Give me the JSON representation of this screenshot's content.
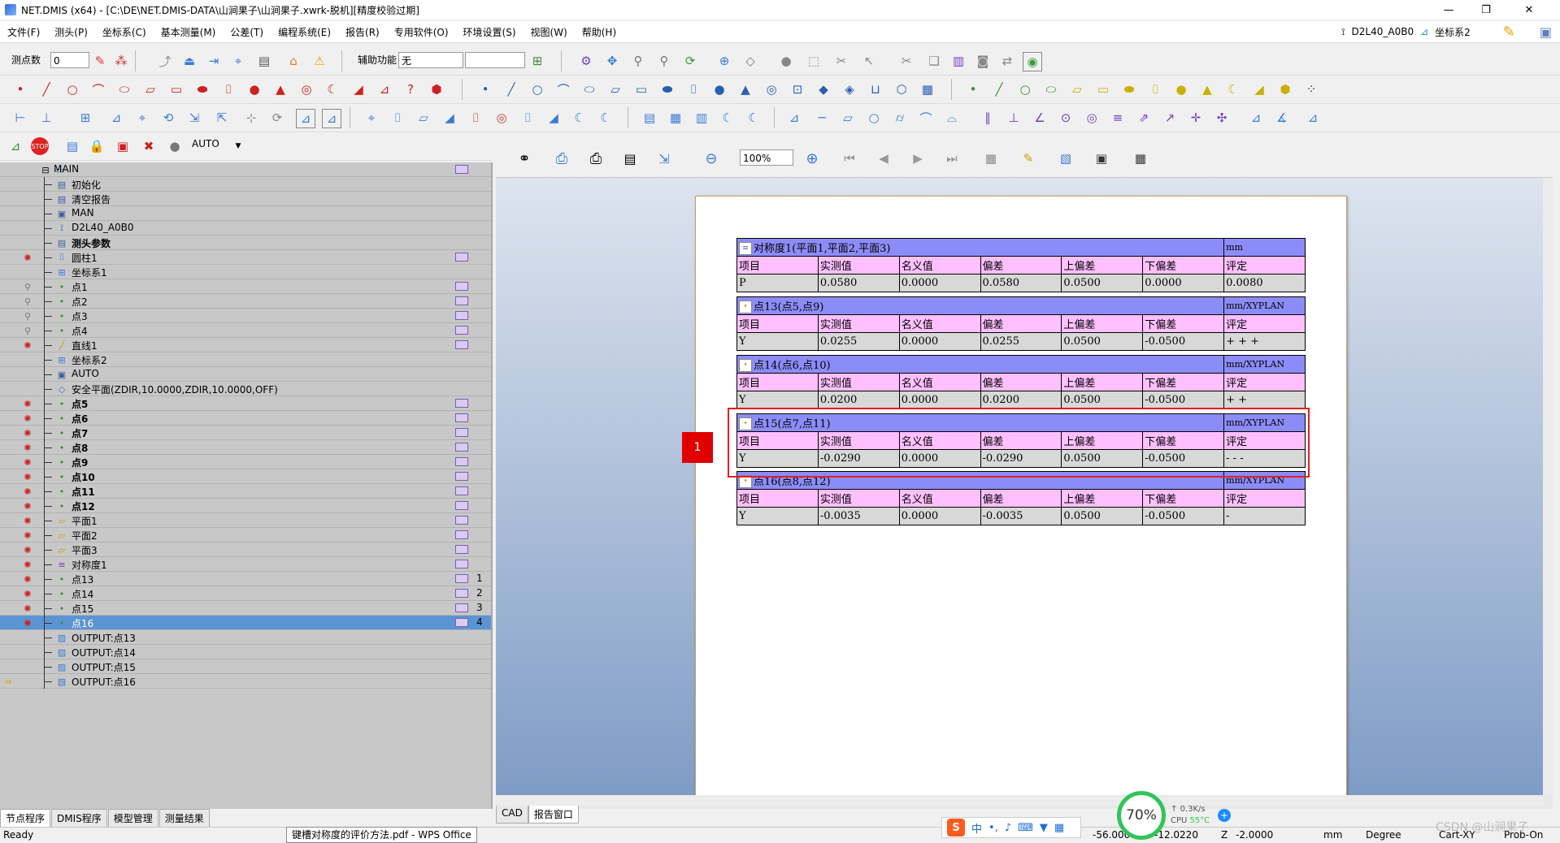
{
  "window": {
    "title": "NET.DMIS (x64) - [C:\\DE\\NET.DMIS-DATA\\山涧果子\\山涧果子.xwrk-脱机][精度校验过期]",
    "min": "—",
    "max": "❐",
    "close": "✕"
  },
  "menu": {
    "items": [
      "文件(F)",
      "测头(P)",
      "坐标系(C)",
      "基本测量(M)",
      "公差(T)",
      "编程系统(E)",
      "报告(R)",
      "专用软件(O)",
      "环境设置(S)",
      "视图(W)",
      "帮助(H)"
    ],
    "probe": "D2L40_A0B0",
    "cs": "坐标系2"
  },
  "toolbar": {
    "points_label": "测点数",
    "points_value": "0",
    "aux_label": "辅助功能",
    "aux_value": "无",
    "mode_value": "AUTO",
    "zoom_value": "100%"
  },
  "tree": {
    "rows": [
      {
        "label": "MAIN",
        "bold": false,
        "icon": "main-icon",
        "mark": true,
        "num": "",
        "gut": "",
        "indent": 0
      },
      {
        "label": "初始化",
        "bold": false,
        "icon": "init-icon",
        "mark": false,
        "num": "",
        "gut": "",
        "indent": 1
      },
      {
        "label": "清空报告",
        "bold": false,
        "icon": "clear-report-icon",
        "mark": false,
        "num": "",
        "gut": "",
        "indent": 1
      },
      {
        "label": "MAN",
        "bold": false,
        "icon": "mode-icon",
        "mark": false,
        "num": "",
        "gut": "",
        "indent": 1
      },
      {
        "label": "D2L40_A0B0",
        "bold": false,
        "icon": "probe-icon",
        "mark": false,
        "num": "",
        "gut": "",
        "indent": 1
      },
      {
        "label": "测头参数",
        "bold": true,
        "icon": "probe-param-icon",
        "mark": false,
        "num": "",
        "gut": "",
        "indent": 1
      },
      {
        "label": "圆柱1",
        "bold": false,
        "icon": "cylinder-icon",
        "mark": true,
        "num": "",
        "gut": "bulb",
        "indent": 1
      },
      {
        "label": "坐标系1",
        "bold": false,
        "icon": "coord-icon",
        "mark": false,
        "num": "",
        "gut": "",
        "indent": 1
      },
      {
        "label": "点1",
        "bold": false,
        "icon": "point-icon",
        "mark": true,
        "num": "",
        "gut": "probe",
        "indent": 1
      },
      {
        "label": "点2",
        "bold": false,
        "icon": "point-icon",
        "mark": true,
        "num": "",
        "gut": "probe",
        "indent": 1
      },
      {
        "label": "点3",
        "bold": false,
        "icon": "point-icon",
        "mark": true,
        "num": "",
        "gut": "probe",
        "indent": 1
      },
      {
        "label": "点4",
        "bold": false,
        "icon": "point-icon",
        "mark": true,
        "num": "",
        "gut": "probe",
        "indent": 1
      },
      {
        "label": "直线1",
        "bold": false,
        "icon": "line-icon",
        "mark": true,
        "num": "",
        "gut": "bulb",
        "indent": 1
      },
      {
        "label": "坐标系2",
        "bold": false,
        "icon": "coord-icon",
        "mark": false,
        "num": "",
        "gut": "",
        "indent": 1
      },
      {
        "label": "AUTO",
        "bold": false,
        "icon": "mode-icon",
        "mark": false,
        "num": "",
        "gut": "",
        "indent": 1
      },
      {
        "label": "安全平面(ZDIR,10.0000,ZDIR,10.0000,OFF)",
        "bold": false,
        "icon": "safe-plane-icon",
        "mark": false,
        "num": "",
        "gut": "",
        "indent": 1
      },
      {
        "label": "点5",
        "bold": true,
        "icon": "point-icon",
        "mark": true,
        "num": "",
        "gut": "bulb",
        "indent": 1
      },
      {
        "label": "点6",
        "bold": true,
        "icon": "point-icon",
        "mark": true,
        "num": "",
        "gut": "bulb",
        "indent": 1
      },
      {
        "label": "点7",
        "bold": true,
        "icon": "point-icon",
        "mark": true,
        "num": "",
        "gut": "bulb",
        "indent": 1
      },
      {
        "label": "点8",
        "bold": true,
        "icon": "point-icon",
        "mark": true,
        "num": "",
        "gut": "bulb",
        "indent": 1
      },
      {
        "label": "点9",
        "bold": true,
        "icon": "point-icon",
        "mark": true,
        "num": "",
        "gut": "bulb",
        "indent": 1
      },
      {
        "label": "点10",
        "bold": true,
        "icon": "point-icon",
        "mark": true,
        "num": "",
        "gut": "bulb",
        "indent": 1
      },
      {
        "label": "点11",
        "bold": true,
        "icon": "point-icon",
        "mark": true,
        "num": "",
        "gut": "bulb",
        "indent": 1
      },
      {
        "label": "点12",
        "bold": true,
        "icon": "point-icon",
        "mark": true,
        "num": "",
        "gut": "bulb",
        "indent": 1
      },
      {
        "label": "平面1",
        "bold": false,
        "icon": "plane-icon",
        "mark": true,
        "num": "",
        "gut": "bulb",
        "indent": 1
      },
      {
        "label": "平面2",
        "bold": false,
        "icon": "plane-icon",
        "mark": true,
        "num": "",
        "gut": "bulb",
        "indent": 1
      },
      {
        "label": "平面3",
        "bold": false,
        "icon": "plane-icon",
        "mark": true,
        "num": "",
        "gut": "bulb",
        "indent": 1
      },
      {
        "label": "对称度1",
        "bold": false,
        "icon": "symmetry-icon",
        "mark": true,
        "num": "",
        "gut": "bulb",
        "indent": 1
      },
      {
        "label": "点13",
        "bold": false,
        "icon": "point-icon",
        "mark": true,
        "num": "1",
        "gut": "bulb",
        "indent": 1
      },
      {
        "label": "点14",
        "bold": false,
        "icon": "point-icon",
        "mark": true,
        "num": "2",
        "gut": "bulb",
        "indent": 1
      },
      {
        "label": "点15",
        "bold": false,
        "icon": "point-icon",
        "mark": true,
        "num": "3",
        "gut": "bulb",
        "indent": 1
      },
      {
        "label": "点16",
        "bold": false,
        "icon": "point-icon",
        "mark": true,
        "num": "4",
        "gut": "bulb",
        "indent": 1,
        "selected": true
      },
      {
        "label": "OUTPUT:点13",
        "bold": false,
        "icon": "output-icon",
        "mark": false,
        "num": "",
        "gut": "",
        "indent": 1
      },
      {
        "label": "OUTPUT:点14",
        "bold": false,
        "icon": "output-icon",
        "mark": false,
        "num": "",
        "gut": "",
        "indent": 1
      },
      {
        "label": "OUTPUT:点15",
        "bold": false,
        "icon": "output-icon",
        "mark": false,
        "num": "",
        "gut": "",
        "indent": 1
      },
      {
        "label": "OUTPUT:点16",
        "bold": false,
        "icon": "output-icon",
        "mark": false,
        "num": "",
        "gut": "arrow",
        "indent": 1
      }
    ]
  },
  "left_tabs": [
    "节点程序",
    "DMIS程序",
    "模型管理",
    "测量结果"
  ],
  "right_tabs": [
    "CAD",
    "报告窗口"
  ],
  "report": {
    "columns": [
      "项目",
      "实测值",
      "名义值",
      "偏差",
      "上偏差",
      "下偏差",
      "评定"
    ],
    "tables": [
      {
        "title": "对称度1(平面1,平面2,平面3)",
        "unit": "mm",
        "icon": "symmetry-icon",
        "row": [
          "P",
          "0.0580",
          "0.0000",
          "0.0580",
          "0.0500",
          "0.0000",
          "0.0080"
        ]
      },
      {
        "title": "点13(点5,点9)",
        "unit": "mm/XYPLAN",
        "icon": "point-icon",
        "row": [
          "Y",
          "0.0255",
          "0.0000",
          "0.0255",
          "0.0500",
          "-0.0500",
          "+ + +"
        ]
      },
      {
        "title": "点14(点6,点10)",
        "unit": "mm/XYPLAN",
        "icon": "point-icon",
        "row": [
          "Y",
          "0.0200",
          "0.0000",
          "0.0200",
          "0.0500",
          "-0.0500",
          "+ +"
        ]
      },
      {
        "title": "点15(点7,点11)",
        "unit": "mm/XYPLAN",
        "icon": "point-icon",
        "row": [
          "Y",
          "-0.0290",
          "0.0000",
          "-0.0290",
          "0.0500",
          "-0.0500",
          "- - -"
        ]
      },
      {
        "title": "点16(点8,点12)",
        "unit": "mm/XYPLAN",
        "icon": "point-icon",
        "row": [
          "Y",
          "-0.0035",
          "0.0000",
          "-0.0035",
          "0.0500",
          "-0.0500",
          "-"
        ]
      }
    ],
    "badge": "1"
  },
  "status": {
    "ready": "Ready",
    "tooltip": "键槽对称度的评价方法.pdf - WPS Office",
    "x": "-56.0000",
    "y": "-12.0220",
    "zlabel": "Z",
    "z": "-2.0000",
    "unit": "mm",
    "angle": "Degree",
    "cart": "Cart-XY",
    "probe": "Prob-On"
  },
  "sysinfo": {
    "cpu_percent": "70%",
    "net": "0.3K/s",
    "cpu_temp_label": "CPU",
    "cpu_temp": "55°C",
    "watermark": "CSDN @山涧果子"
  }
}
